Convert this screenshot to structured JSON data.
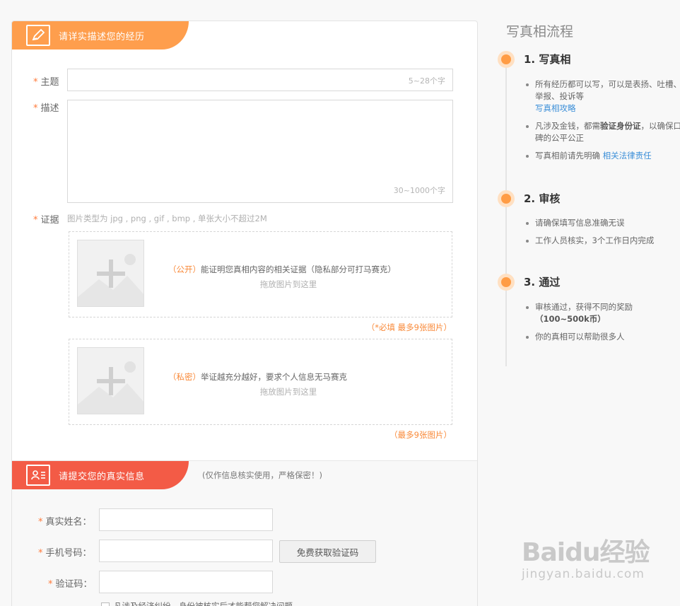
{
  "form": {
    "section1_title": "请详实描述您的经历",
    "required_mark": "*",
    "subject_label": "主题",
    "subject_hint": "5~28个字",
    "desc_label": "描述",
    "desc_hint": "30~1000个字",
    "evidence_label": "证据",
    "evidence_hint": "图片类型为 jpg , png , gif , bmp , 单张大小不超过2M",
    "public_zone": {
      "tag": "（公开）",
      "text": "能证明您真相内容的相关证据（隐私部分可打马赛克）",
      "drop_text": "拖放图片到这里",
      "limit": "（*必填 最多9张图片）"
    },
    "private_zone": {
      "tag": "（私密）",
      "text": "举证越充分越好，要求个人信息无马赛克",
      "drop_text": "拖放图片到这里",
      "limit": "（最多9张图片）"
    },
    "section2_title": "请提交您的真实信息",
    "section2_note": "(仅作信息核实使用，严格保密！)",
    "name_label": "真实姓名：",
    "phone_label": "手机号码：",
    "code_label": "验证码：",
    "get_code_button": "免费获取验证码",
    "checkbox_label": "凡涉及经济纠纷，身份被核实后才能帮您解决问题"
  },
  "process": {
    "title": "写真相流程",
    "steps": [
      {
        "title": "1. 写真相",
        "b1": "所有经历都可以写，可以是表扬、吐槽、举报、投诉等",
        "b1_link": "写真相攻略",
        "b2_pre": "凡涉及金钱，都需",
        "b2_bold": "验证身份证",
        "b2_post": "，以确保口碑的公平公正",
        "b3_pre": "写真相前请先明确 ",
        "b3_link": "相关法律责任"
      },
      {
        "title": "2. 审核",
        "b1": "请确保填写信息准确无误",
        "b2": "工作人员核实，3个工作日内完成"
      },
      {
        "title": "3. 通过",
        "b1": "审核通过，获得不同的奖励",
        "b1_bold": "（100~500k币）",
        "b2": "你的真相可以帮助很多人"
      }
    ]
  },
  "watermark": {
    "main": "Baidu经验",
    "sub": "jingyan.baidu.com"
  },
  "colors": {
    "orange": "#fe9e4d",
    "red": "#f35b46",
    "link": "#3c8fd8"
  }
}
